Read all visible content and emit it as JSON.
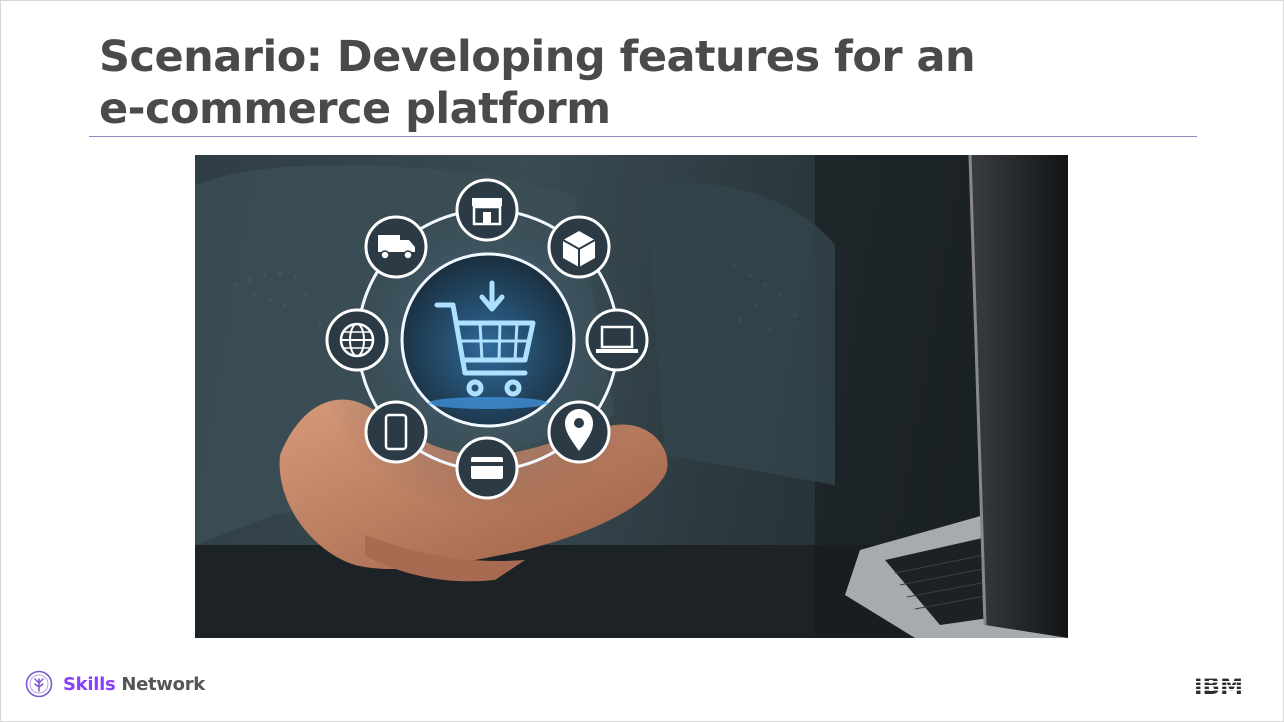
{
  "slide": {
    "title_line1": "Scenario: Developing features for an",
    "title_line2": "e-commerce platform"
  },
  "hero_image": {
    "alt": "Hands holding a glowing e-commerce shopping cart icon ring next to a laptop",
    "icons": [
      "store-icon",
      "package-icon",
      "laptop-icon",
      "location-pin-icon",
      "credit-card-icon",
      "smartphone-icon",
      "globe-icon",
      "delivery-truck-icon",
      "shopping-cart-download-icon"
    ]
  },
  "footer": {
    "brand_skills": "Skills",
    "brand_network": " Network",
    "ibm_logo": "IBM"
  },
  "colors": {
    "title": "#4a4a4a",
    "rule": "#8a8fbf",
    "brand_purple": "#8a3ffc",
    "glow": "#cfe9ff"
  }
}
